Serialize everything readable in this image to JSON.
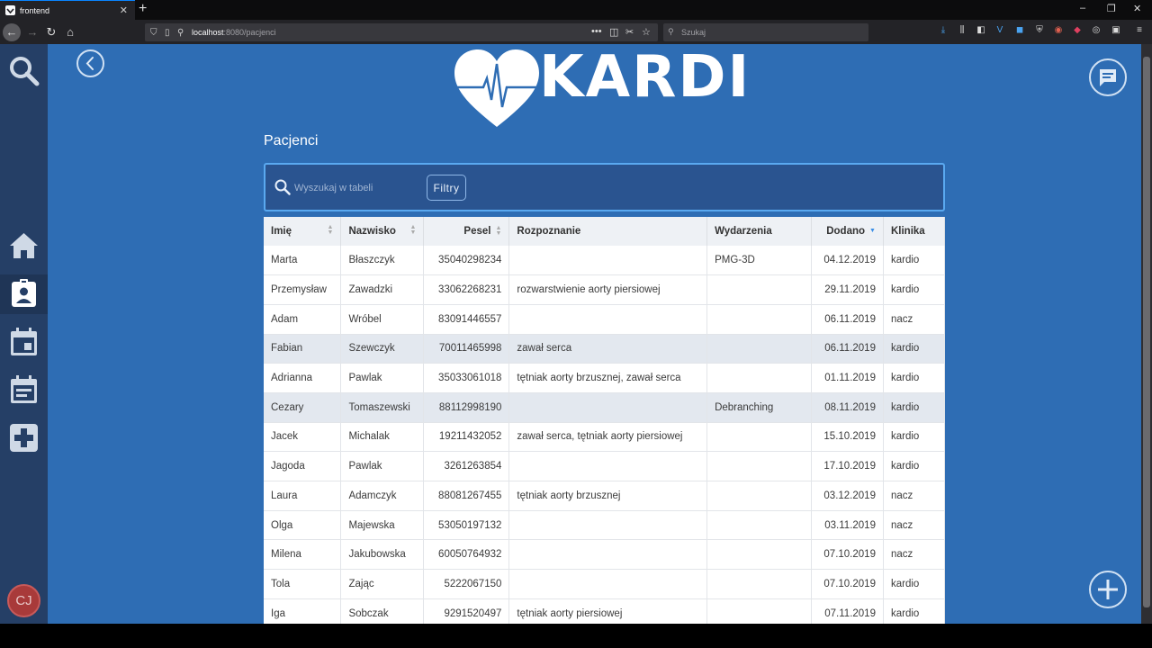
{
  "browser": {
    "tab_title": "frontend",
    "url_host": "localhost",
    "url_path": ":8080/pacjenci",
    "search_placeholder": "Szukaj"
  },
  "app": {
    "logo_text": "KARDI",
    "page_title": "Pacjenci",
    "search_placeholder": "Wyszukaj w tabeli",
    "filter_button": "Filtry",
    "avatar_initials": "CJ",
    "colors": {
      "background": "#2e6db4",
      "sidebar": "#253f66",
      "accent": "#5aa9f0"
    }
  },
  "table": {
    "columns": [
      "Imię",
      "Nazwisko",
      "Pesel",
      "Rozpoznanie",
      "Wydarzenia",
      "Dodano",
      "Klinika"
    ],
    "rows": [
      [
        "Marta",
        "Błaszczyk",
        "35040298234",
        "",
        "PMG-3D",
        "04.12.2019",
        "kardio"
      ],
      [
        "Przemysław",
        "Zawadzki",
        "33062268231",
        "rozwarstwienie aorty piersiowej",
        "",
        "29.11.2019",
        "kardio"
      ],
      [
        "Adam",
        "Wróbel",
        "83091446557",
        "",
        "",
        "06.11.2019",
        "nacz"
      ],
      [
        "Fabian",
        "Szewczyk",
        "70011465998",
        "zawał serca",
        "",
        "06.11.2019",
        "kardio"
      ],
      [
        "Adrianna",
        "Pawlak",
        "35033061018",
        "tętniak aorty brzusznej, zawał serca",
        "",
        "01.11.2019",
        "kardio"
      ],
      [
        "Cezary",
        "Tomaszewski",
        "88112998190",
        "",
        "Debranching",
        "08.11.2019",
        "kardio"
      ],
      [
        "Jacek",
        "Michalak",
        "19211432052",
        "zawał serca, tętniak aorty piersiowej",
        "",
        "15.10.2019",
        "kardio"
      ],
      [
        "Jagoda",
        "Pawlak",
        "3261263854",
        "",
        "",
        "17.10.2019",
        "kardio"
      ],
      [
        "Laura",
        "Adamczyk",
        "88081267455",
        "tętniak aorty brzusznej",
        "",
        "03.12.2019",
        "nacz"
      ],
      [
        "Olga",
        "Majewska",
        "53050197132",
        "",
        "",
        "03.11.2019",
        "nacz"
      ],
      [
        "Milena",
        "Jakubowska",
        "60050764932",
        "",
        "",
        "07.10.2019",
        "nacz"
      ],
      [
        "Tola",
        "Zając",
        "5222067150",
        "",
        "",
        "07.10.2019",
        "kardio"
      ],
      [
        "Iga",
        "Sobczak",
        "9291520497",
        "tętniak aorty piersiowej",
        "",
        "07.11.2019",
        "kardio"
      ]
    ]
  }
}
